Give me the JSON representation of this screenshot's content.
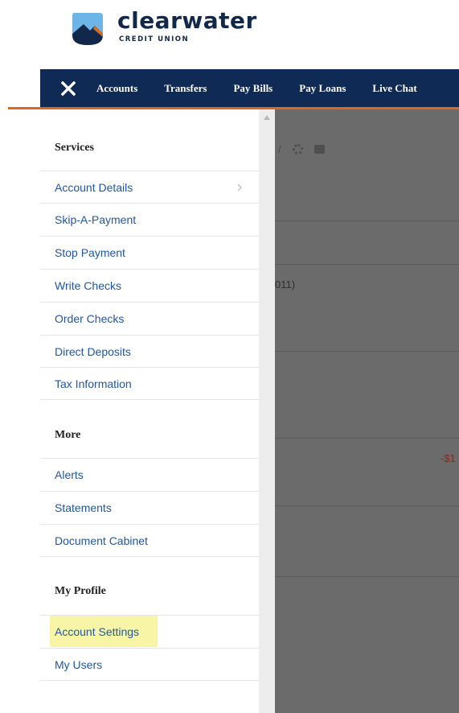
{
  "brand": {
    "name": "clearwater",
    "subtitle": "CREDIT UNION",
    "colors": {
      "navy": "#0f2a54",
      "orange": "#d66a1e",
      "sky": "#6cb5e6",
      "link": "#2257a3"
    }
  },
  "nav": {
    "close_icon": "close-x-icon",
    "items": [
      "Accounts",
      "Transfers",
      "Pay Bills",
      "Pay Loans",
      "Live Chat"
    ]
  },
  "menu": {
    "sections": [
      {
        "title": "Services",
        "items": [
          {
            "label": "Account Details",
            "has_chevron": true
          },
          {
            "label": "Skip-A-Payment"
          },
          {
            "label": "Stop Payment"
          },
          {
            "label": "Write Checks"
          },
          {
            "label": "Order Checks"
          },
          {
            "label": "Direct Deposits"
          },
          {
            "label": "Tax Information"
          }
        ]
      },
      {
        "title": "More",
        "items": [
          {
            "label": "Alerts"
          },
          {
            "label": "Statements"
          },
          {
            "label": "Document Cabinet"
          }
        ]
      },
      {
        "title": "My Profile",
        "items": [
          {
            "label": "Account Settings",
            "highlighted": true
          },
          {
            "label": "My Users"
          }
        ]
      }
    ]
  },
  "background": {
    "partial_text_1": "011)",
    "partial_amount": "-$1",
    "partial_icon_separator": "/",
    "icons": [
      "gear-icon",
      "print-icon"
    ]
  }
}
